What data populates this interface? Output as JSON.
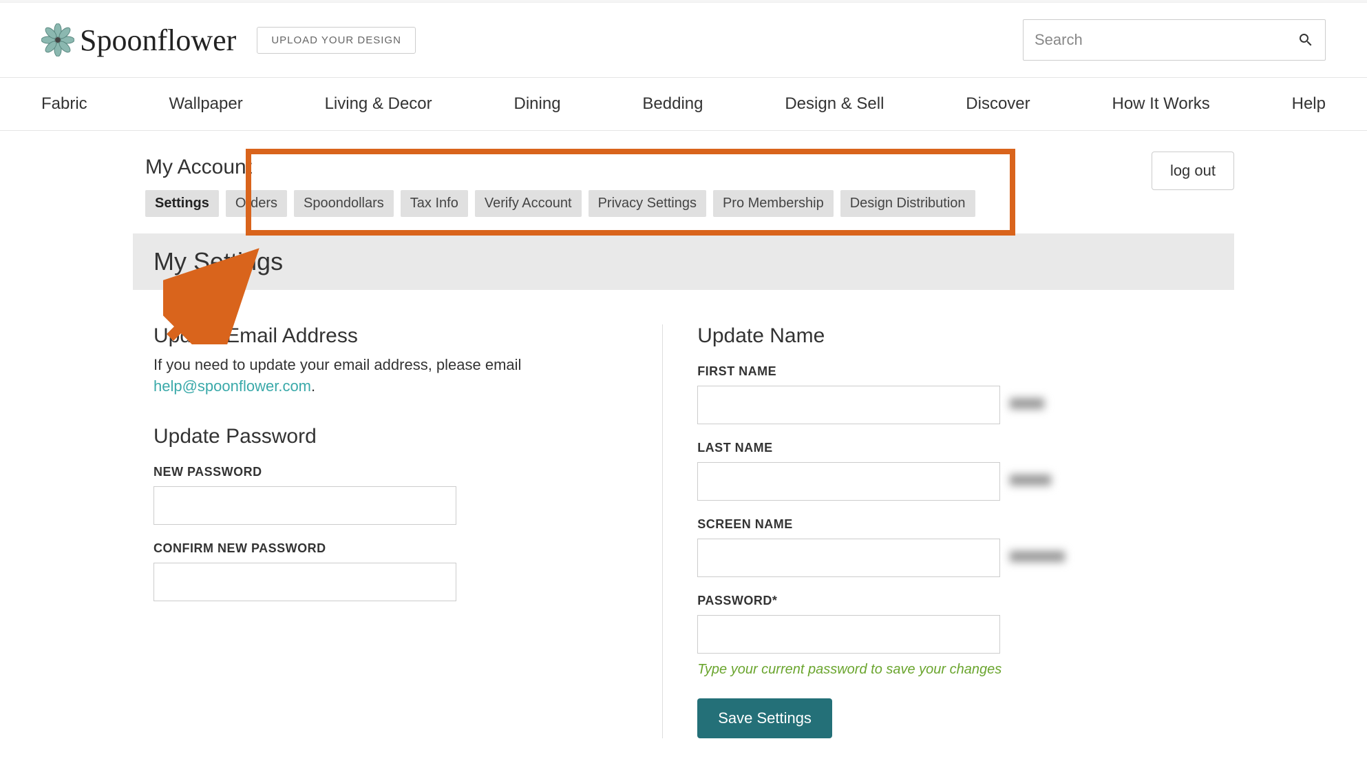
{
  "header": {
    "brand": "Spoonflower",
    "upload_label": "UPLOAD YOUR DESIGN",
    "search_placeholder": "Search"
  },
  "nav": {
    "items": [
      "Fabric",
      "Wallpaper",
      "Living & Decor",
      "Dining",
      "Bedding",
      "Design & Sell",
      "Discover",
      "How It Works",
      "Help"
    ]
  },
  "account": {
    "title": "My Account",
    "logout_label": "log out",
    "tabs": [
      "Settings",
      "Orders",
      "Spoondollars",
      "Tax Info",
      "Verify Account",
      "Privacy Settings",
      "Pro Membership",
      "Design Distribution"
    ],
    "active_tab": "Settings"
  },
  "settings": {
    "page_title": "My Settings",
    "email": {
      "title": "Update Email Address",
      "helper_prefix": "If you need to update your email address, please email ",
      "help_email": "help@spoonflower.com",
      "helper_suffix": "."
    },
    "password": {
      "title": "Update Password",
      "new_label": "NEW PASSWORD",
      "confirm_label": "CONFIRM NEW PASSWORD"
    },
    "name": {
      "title": "Update Name",
      "first_label": "FIRST NAME",
      "last_label": "LAST NAME",
      "screen_label": "SCREEN NAME",
      "password_label": "PASSWORD*",
      "password_hint": "Type your current password to save your changes",
      "save_label": "Save Settings"
    }
  }
}
